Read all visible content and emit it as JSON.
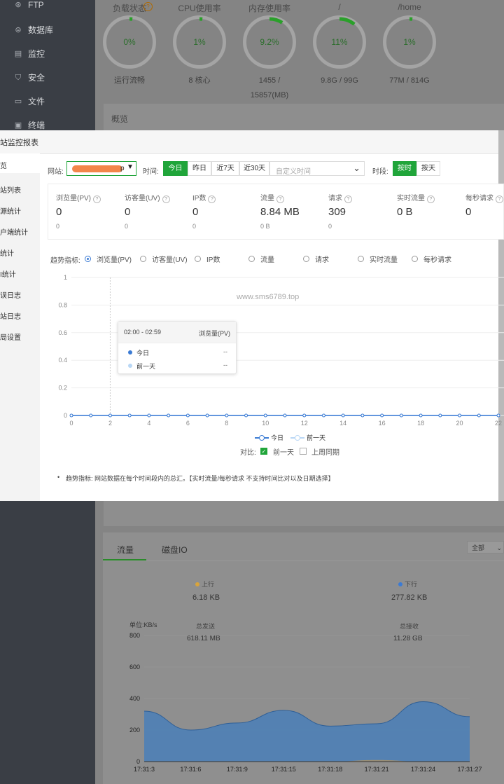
{
  "sidebar": {
    "items": [
      {
        "label": "FTP",
        "icon": "ftp-icon"
      },
      {
        "label": "数据库",
        "icon": "database-icon"
      },
      {
        "label": "监控",
        "icon": "monitor-icon"
      },
      {
        "label": "安全",
        "icon": "shield-icon"
      },
      {
        "label": "文件",
        "icon": "folder-icon"
      },
      {
        "label": "终端",
        "icon": "terminal-icon"
      }
    ]
  },
  "status": {
    "gauges": [
      {
        "title": "负载状态",
        "value": "0%",
        "sub": "运行流畅",
        "fill": 0.0
      },
      {
        "title": "CPU使用率",
        "value": "1%",
        "sub": "8 核心",
        "fill": 0.01
      },
      {
        "title": "内存使用率",
        "value": "9.2%",
        "sub": "1455 / 15857(MB)",
        "fill": 0.092
      },
      {
        "title": "/",
        "value": "11%",
        "sub": "9.8G / 99G",
        "fill": 0.11
      },
      {
        "title": "/home",
        "value": "1%",
        "sub": "77M / 814G",
        "fill": 0.01
      }
    ],
    "overview_title": "概览"
  },
  "dialog": {
    "title": "站监控报表",
    "nav": [
      "览",
      "站列表",
      "源统计",
      "户端统计",
      "统计",
      "I统计",
      "误日志",
      "站日志",
      "局设置"
    ],
    "filters": {
      "site_label": "网站:",
      "site_value": "p",
      "time_label": "时间:",
      "time_buttons": [
        "今日",
        "昨日",
        "近7天",
        "近30天"
      ],
      "custom_time_placeholder": "自定义时间",
      "period_label": "时段:",
      "period_buttons": [
        "按时",
        "按天"
      ]
    },
    "stats": [
      {
        "label": "浏览量(PV)",
        "value": "0",
        "sub": "0"
      },
      {
        "label": "访客量(UV)",
        "value": "0",
        "sub": "0"
      },
      {
        "label": "IP数",
        "value": "0",
        "sub": "0"
      },
      {
        "label": "流量",
        "value": "8.84 MB",
        "sub": "0 B"
      },
      {
        "label": "请求",
        "value": "309",
        "sub": "0"
      },
      {
        "label": "实时流量",
        "value": "0 B",
        "sub": ""
      },
      {
        "label": "每秒请求",
        "value": "0",
        "sub": ""
      }
    ],
    "trend_label": "趋势指标:",
    "trend_options": [
      "浏览量(PV)",
      "访客量(UV)",
      "IP数",
      "流量",
      "请求",
      "实时流量",
      "每秒请求"
    ],
    "watermark": "www.sms6789.top",
    "tooltip": {
      "range": "02:00 - 02:59",
      "metric": "浏览量(PV)",
      "rows": [
        {
          "name": "今日",
          "value": "--",
          "color": "#3b7bd4"
        },
        {
          "name": "前一天",
          "value": "--",
          "color": "#b9d7f5"
        }
      ]
    },
    "legend": [
      "今日",
      "前一天"
    ],
    "compare_label": "对比:",
    "compare_options": [
      {
        "label": "前一天",
        "checked": true
      },
      {
        "label": "上周同期",
        "checked": false
      }
    ],
    "note": "趋势指标: 网站数据在每个时间段内的总汇。【实时流量/每秒请求 不支持时间比对以及日期选择】"
  },
  "chart_data": [
    {
      "type": "line",
      "x": [
        0,
        1,
        2,
        3,
        4,
        5,
        6,
        7,
        8,
        9,
        10,
        11,
        12,
        13,
        14,
        15,
        16,
        17,
        18,
        19,
        20,
        21,
        22
      ],
      "x_ticks": [
        "0",
        "2",
        "4",
        "6",
        "8",
        "10",
        "12",
        "14",
        "16",
        "18",
        "20",
        "22"
      ],
      "y_ticks": [
        "0",
        "0.2",
        "0.4",
        "0.6",
        "0.8",
        "1"
      ],
      "ylim": [
        0,
        1
      ],
      "series": [
        {
          "name": "今日",
          "values": [
            0,
            0,
            0,
            0,
            0,
            0,
            0,
            0,
            0,
            0,
            0,
            0,
            0,
            0,
            0,
            0,
            0,
            0,
            0,
            0,
            0,
            0,
            0
          ],
          "color": "#3b7bd4"
        },
        {
          "name": "前一天",
          "values": [
            0,
            0,
            0,
            0,
            0,
            0,
            0,
            0,
            0,
            0,
            0,
            0,
            0,
            0,
            0,
            0,
            0,
            0,
            0,
            0,
            0,
            0,
            0
          ],
          "color": "#b9d7f5"
        }
      ]
    },
    {
      "type": "area",
      "tabs": [
        "流量",
        "磁盘IO"
      ],
      "select_value": "全部",
      "up": {
        "label": "上行",
        "value": "6.18 KB",
        "total_label": "总发送",
        "total": "618.11 MB",
        "color": "#d9a43b"
      },
      "down": {
        "label": "下行",
        "value": "277.82 KB",
        "total_label": "总接收",
        "total": "11.28 GB",
        "color": "#3b7bd4"
      },
      "ylabel": "单位:KB/s",
      "y_ticks": [
        "0",
        "200",
        "400",
        "600",
        "800"
      ],
      "ylim": [
        0,
        800
      ],
      "x_ticks": [
        "17:31:3",
        "17:31:6",
        "17:31:9",
        "17:31:15",
        "17:31:18",
        "17:31:21",
        "17:31:24",
        "17:31:27"
      ],
      "series": [
        {
          "name": "下行",
          "values": [
            320,
            200,
            245,
            325,
            225,
            240,
            380,
            285
          ]
        },
        {
          "name": "上行",
          "values": [
            0,
            0,
            0,
            0,
            0,
            10,
            0,
            0
          ]
        }
      ]
    }
  ]
}
